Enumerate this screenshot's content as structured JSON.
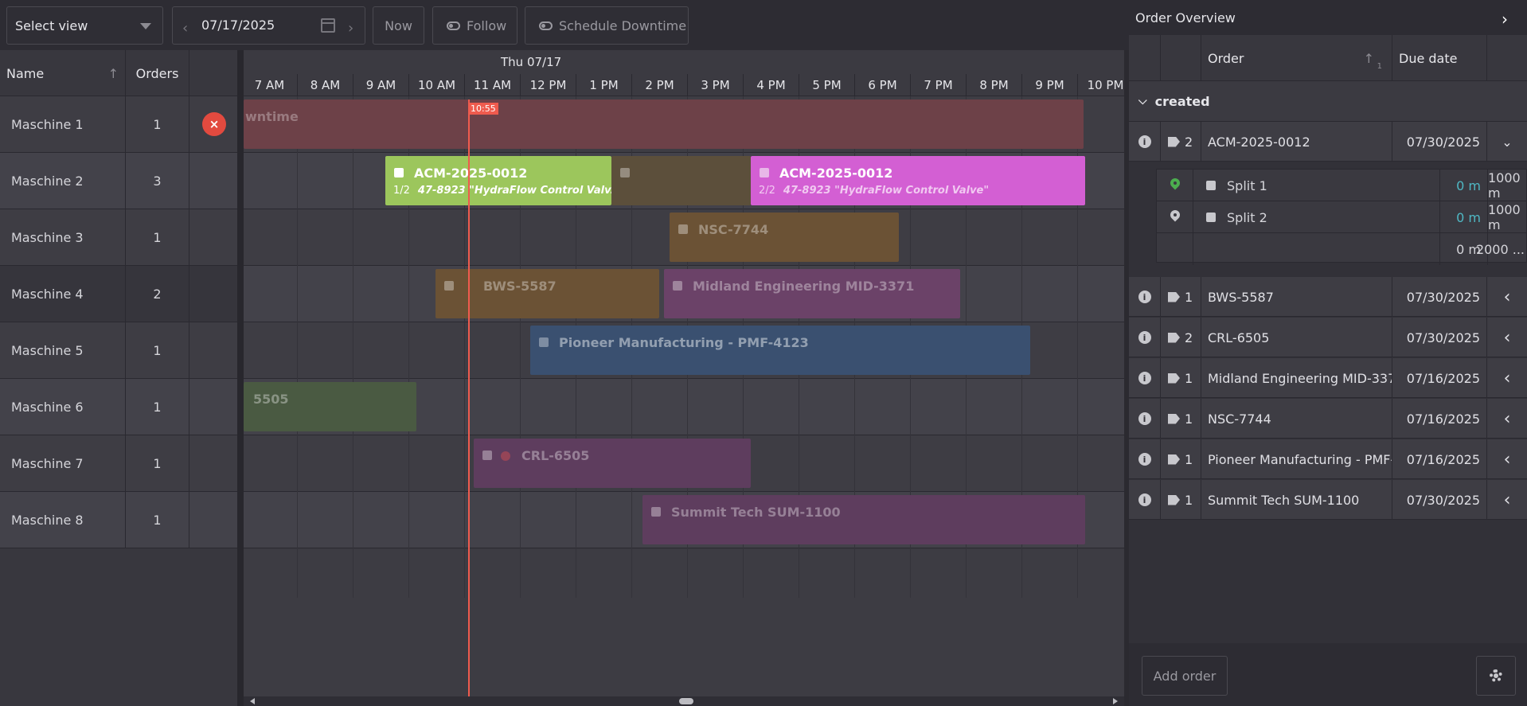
{
  "toolbar": {
    "select_view": "Select view",
    "date": "07/17/2025",
    "prev": "‹",
    "next": "›",
    "now": "Now",
    "follow": "Follow",
    "schedule_downtime": "Schedule Downtime"
  },
  "machines_table": {
    "col_name": "Name",
    "col_orders": "Orders",
    "sort_icon": "↑",
    "rows": [
      {
        "name": "Maschine 1",
        "orders": "1"
      },
      {
        "name": "Maschine 2",
        "orders": "3"
      },
      {
        "name": "Maschine 3",
        "orders": "1"
      },
      {
        "name": "Maschine 4",
        "orders": "2"
      },
      {
        "name": "Maschine 5",
        "orders": "1"
      },
      {
        "name": "Maschine 6",
        "orders": "1"
      },
      {
        "name": "Maschine 7",
        "orders": "1"
      },
      {
        "name": "Maschine 8",
        "orders": "1"
      }
    ],
    "remove_icon": "×"
  },
  "gantt": {
    "day_label": "Thu 07/17",
    "hours": [
      "7 AM",
      "8 AM",
      "9 AM",
      "10 AM",
      "11 AM",
      "12 PM",
      "1 PM",
      "2 PM",
      "3 PM",
      "4 PM",
      "5 PM",
      "6 PM",
      "7 PM",
      "8 PM",
      "9 PM",
      "10 PM"
    ],
    "now_label": "10:55",
    "bars": {
      "downtime": "wntime",
      "m2a_title": "ACM-2025-0012",
      "m2a_split": "1/2",
      "m2a_desc": "47-8923 \"HydraFlow Control Valv...",
      "m2b_title": "ACM-2025-0012",
      "m2b_split": "2/2",
      "m2b_desc": "47-8923 \"HydraFlow Control Valve\"",
      "m3_title": "NSC-7744",
      "m4a_title": "BWS-5587",
      "m4b_title": "Midland Engineering MID-3371",
      "m5_title": "Pioneer Manufacturing - PMF-4123",
      "m6_title": "5505",
      "m7_title": "CRL-6505",
      "m8_title": "Summit Tech SUM-1100"
    }
  },
  "panel": {
    "title": "Order Overview",
    "expand_icon": "›",
    "col_order": "Order",
    "col_due": "Due date",
    "sort_icon": "↑",
    "sort_index": "1",
    "group_label": "created",
    "orders": [
      {
        "count": "2",
        "order": "ACM-2025-0012",
        "due": "07/30/2025",
        "chev": "⌄"
      },
      {
        "count": "1",
        "order": "BWS-5587",
        "due": "07/30/2025",
        "chev": "‹"
      },
      {
        "count": "2",
        "order": "CRL-6505",
        "due": "07/30/2025",
        "chev": "‹"
      },
      {
        "count": "1",
        "order": "Midland Engineering MID-3371",
        "due": "07/16/2025",
        "chev": "‹"
      },
      {
        "count": "1",
        "order": "NSC-7744",
        "due": "07/16/2025",
        "chev": "‹"
      },
      {
        "count": "1",
        "order": "Pioneer Manufacturing - PMF-...",
        "due": "07/16/2025",
        "chev": "‹"
      },
      {
        "count": "1",
        "order": "Summit Tech SUM-1100",
        "due": "07/30/2025",
        "chev": "‹"
      }
    ],
    "splits": [
      {
        "name": "Split 1",
        "done": "0 m",
        "total": "1000 m"
      },
      {
        "name": "Split 2",
        "done": "0 m",
        "total": "1000 m"
      }
    ],
    "split_sum_done": "0 m",
    "split_sum_total": "2000 ...",
    "add_order": "Add order",
    "info_glyph": "i"
  },
  "colors": {
    "accent_red": "#ef5b4e",
    "bar_green": "#9cc65c",
    "bar_magenta": "#d35fd3",
    "bar_orange": "#a7743a",
    "bar_blue": "#3d6fae",
    "pin_green": "#4cae4f",
    "teal_text": "#4fb8c4"
  }
}
